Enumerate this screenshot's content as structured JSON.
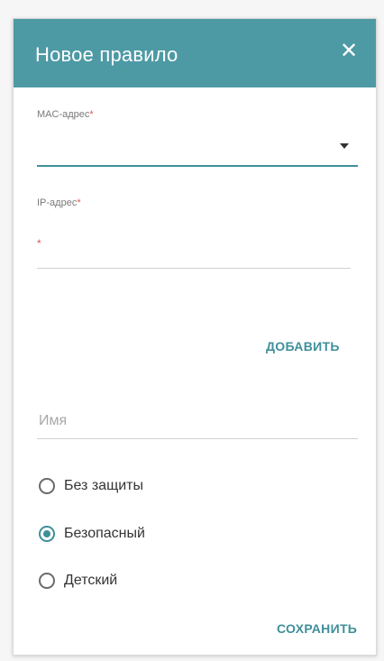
{
  "dialog": {
    "title": "Новое правило",
    "close_icon": "close-icon"
  },
  "mac_field": {
    "label": "MAC-адрес",
    "required_mark": "*",
    "value": ""
  },
  "ip_field": {
    "label": "IP-адрес",
    "required_mark": "*",
    "value": "",
    "error_mark": "*"
  },
  "add_button": {
    "label": "ДОБАВИТЬ"
  },
  "name_field": {
    "placeholder": "Имя",
    "value": ""
  },
  "protection": {
    "options": [
      {
        "label": "Без защиты",
        "checked": false
      },
      {
        "label": "Безопасный",
        "checked": true
      },
      {
        "label": "Детский",
        "checked": false
      }
    ]
  },
  "save_button": {
    "label": "СОХРАНИТЬ"
  },
  "colors": {
    "header": "#4d9aa5",
    "accent": "#3f8f9a",
    "required": "#e05353"
  }
}
